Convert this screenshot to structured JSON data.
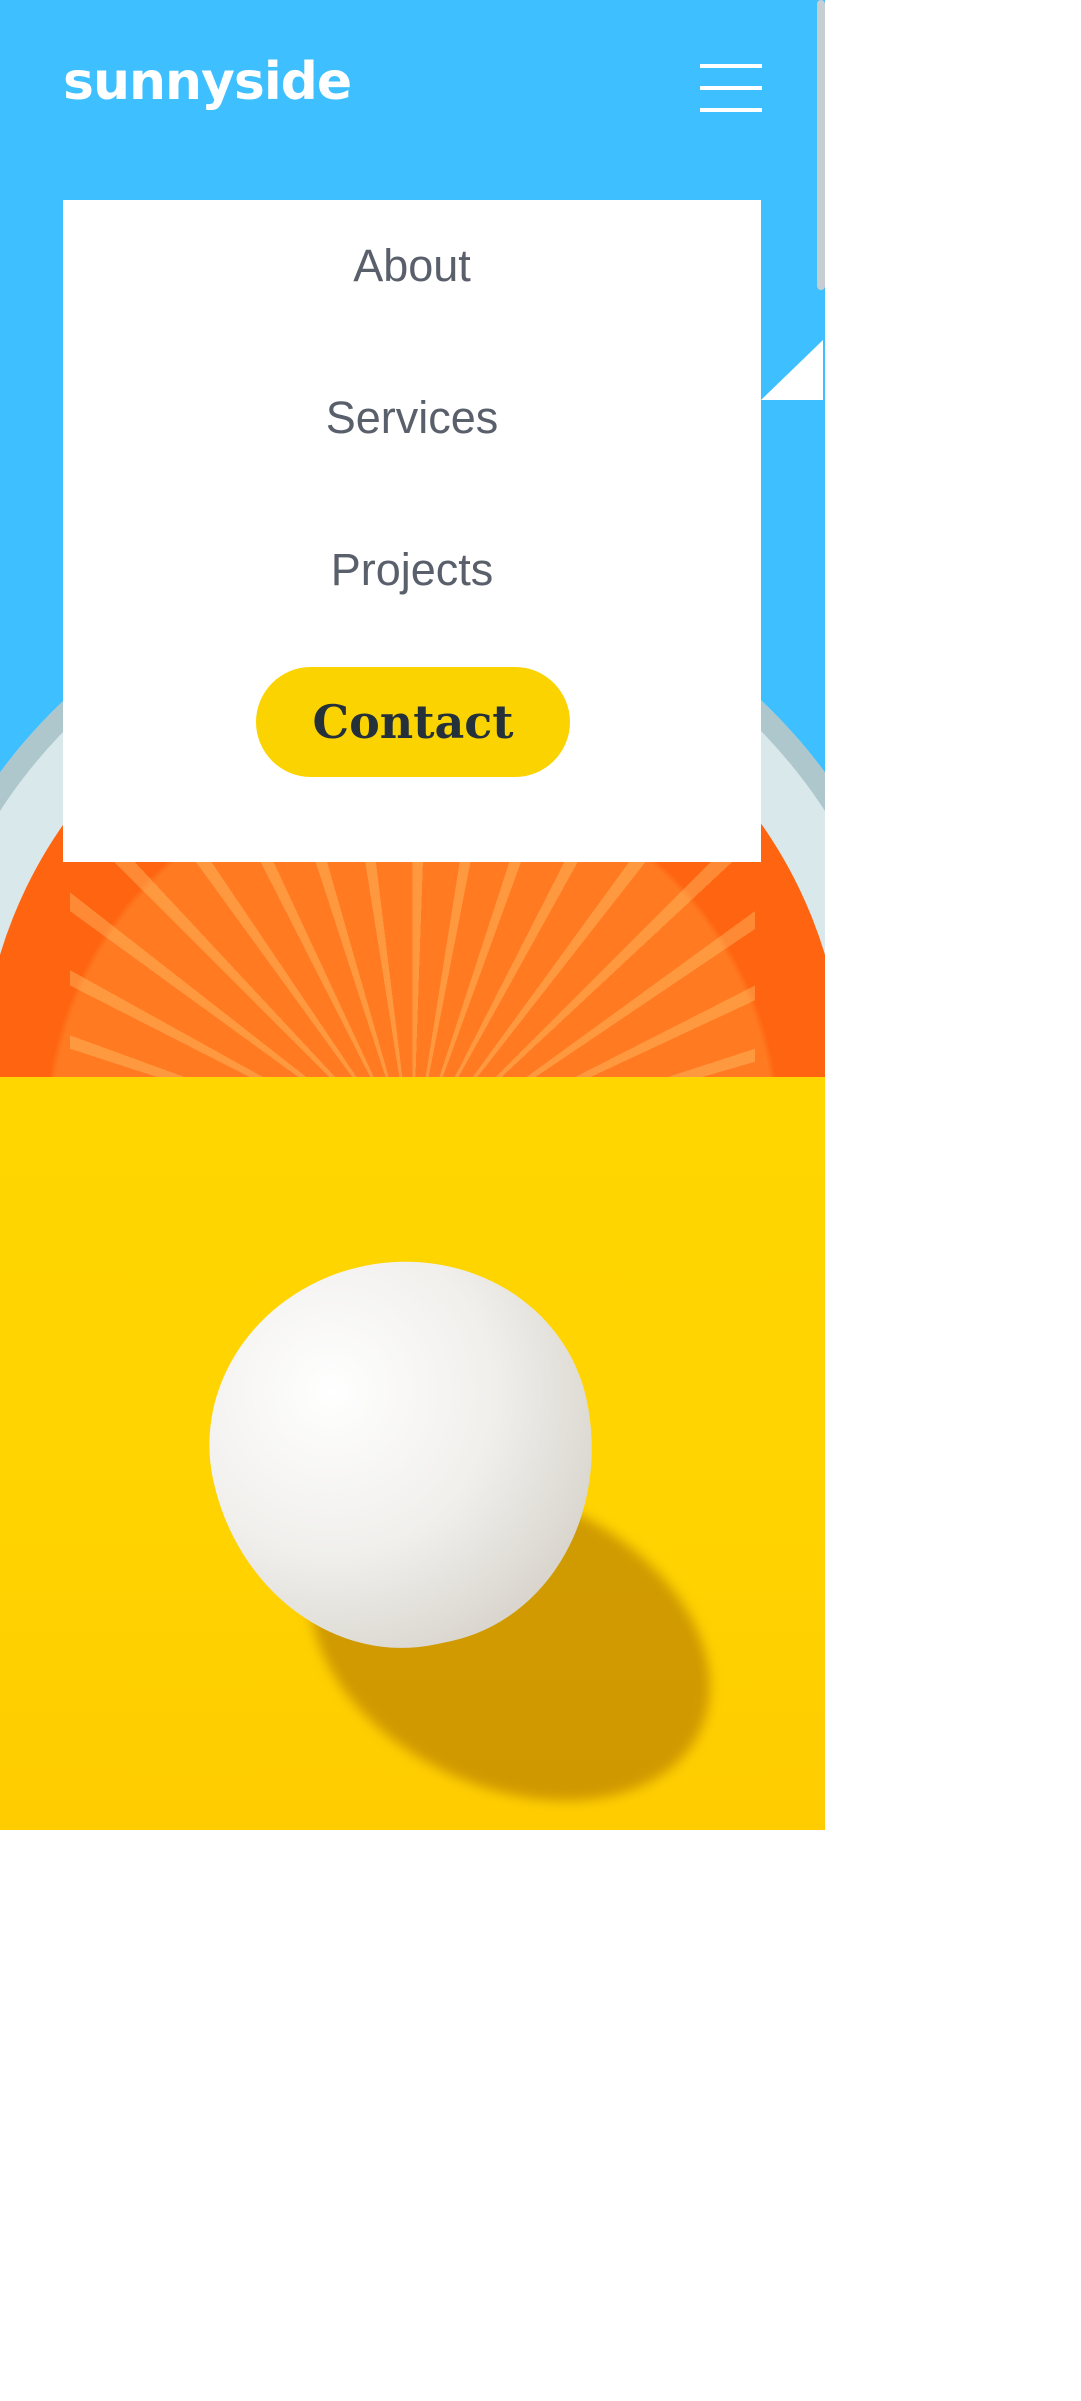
{
  "header": {
    "logo": "sunnyside",
    "menu_icon": "hamburger-menu-icon"
  },
  "menu": {
    "items": [
      {
        "label": "About"
      },
      {
        "label": "Services"
      },
      {
        "label": "Projects"
      }
    ],
    "contact_label": "Contact"
  },
  "colors": {
    "hero_background": "#3ebfff",
    "egg_background": "#ffd600",
    "contact_button": "#fbd300",
    "menu_text": "#5a606b",
    "contact_text": "#24303a"
  },
  "images": {
    "hero": "orange-slice-image",
    "egg": "egg-image"
  }
}
